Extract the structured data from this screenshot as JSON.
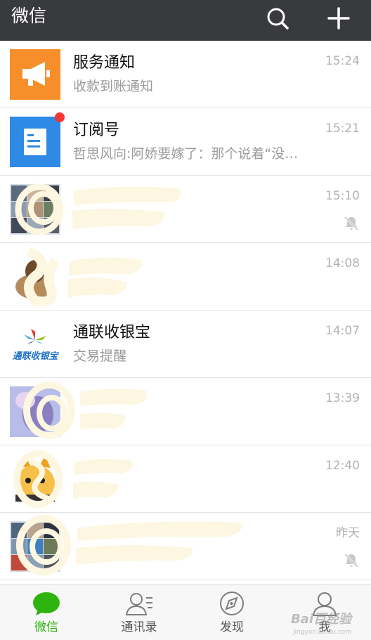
{
  "header": {
    "title": "微信",
    "search_icon": "search-icon",
    "add_icon": "plus-icon",
    "bg_color": "#393a3e"
  },
  "chats": [
    {
      "name": "服务通知",
      "message": "收款到账通知",
      "time": "15:24",
      "avatar": "megaphone-icon",
      "avatar_color": "#f68f2a"
    },
    {
      "name": "订阅号",
      "message": "哲思风向:阿娇要嫁了：那个说着“没…",
      "time": "15:21",
      "avatar": "document-icon",
      "avatar_color": "#2f8ae5",
      "unread_dot": true
    },
    {
      "name": "",
      "message": "",
      "time": "15:10",
      "muted": true,
      "obscured": true
    },
    {
      "name": "",
      "message": "",
      "time": "14:08",
      "obscured": true
    },
    {
      "name": "通联收银宝",
      "message": "交易提醒",
      "time": "14:07",
      "avatar": "tonglian-logo",
      "avatar_text": "通联收银宝"
    },
    {
      "name": "",
      "message": "",
      "time": "13:39",
      "obscured": true
    },
    {
      "name": "",
      "message": "",
      "time": "12:40",
      "obscured": true
    },
    {
      "name": "",
      "message": "",
      "time": "昨天",
      "muted": true,
      "obscured": true
    }
  ],
  "tabs": [
    {
      "label": "微信",
      "icon": "chat-bubble-icon",
      "active": true
    },
    {
      "label": "通讯录",
      "icon": "contacts-icon",
      "active": false
    },
    {
      "label": "发现",
      "icon": "compass-icon",
      "active": false
    },
    {
      "label": "我",
      "icon": "person-icon",
      "active": false
    }
  ],
  "watermark": {
    "text": "Bai百经验",
    "sub": "jingyan.baidu.com"
  },
  "colors": {
    "accent": "#2fb30e",
    "unread": "#f43530",
    "scribble": "#fdf6e1"
  }
}
